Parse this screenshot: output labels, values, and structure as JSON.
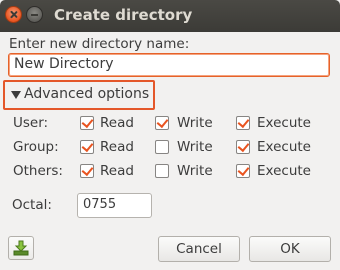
{
  "window": {
    "title": "Create directory"
  },
  "name_field": {
    "label": "Enter new directory name:",
    "value": "New Directory"
  },
  "advanced": {
    "label": "Advanced options",
    "expanded": true
  },
  "permissions": {
    "columns": [
      "Read",
      "Write",
      "Execute"
    ],
    "rows": [
      {
        "label": "User:",
        "read": true,
        "write": true,
        "execute": true
      },
      {
        "label": "Group:",
        "read": true,
        "write": false,
        "execute": true
      },
      {
        "label": "Others:",
        "read": true,
        "write": false,
        "execute": true
      }
    ]
  },
  "octal": {
    "label": "Octal:",
    "value": "0755"
  },
  "buttons": {
    "cancel": "Cancel",
    "ok": "OK",
    "download_icon": "download-icon"
  },
  "colors": {
    "accent": "#e95420",
    "titlebar": "#3c3b37"
  }
}
